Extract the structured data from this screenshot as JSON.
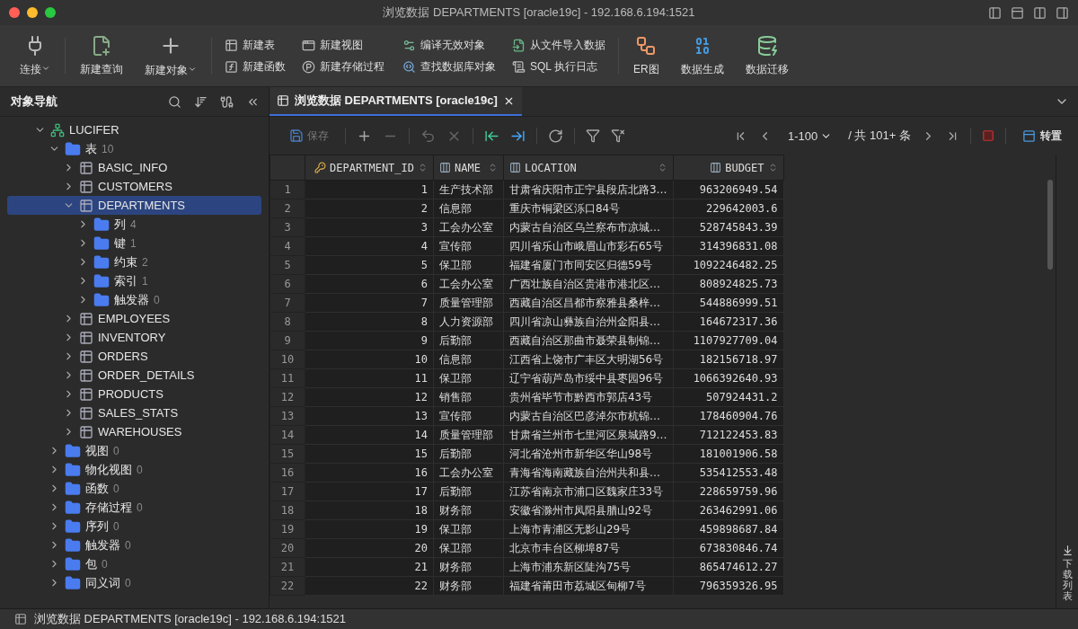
{
  "window": {
    "title": "浏览数据 DEPARTMENTS [oracle19c]  - 192.168.6.194:1521"
  },
  "toolbar": {
    "items": [
      {
        "label": "连接",
        "kind": "large",
        "has_menu": true
      },
      {
        "label": "新建查询",
        "kind": "large"
      },
      {
        "label": "新建对象",
        "kind": "large",
        "has_menu": true
      },
      {
        "label": "新建表",
        "kind": "small"
      },
      {
        "label": "新建函数",
        "kind": "small"
      },
      {
        "label": "新建视图",
        "kind": "small"
      },
      {
        "label": "新建存储过程",
        "kind": "small"
      },
      {
        "label": "编译无效对象",
        "kind": "small"
      },
      {
        "label": "查找数据库对象",
        "kind": "small"
      },
      {
        "label": "从文件导入数据",
        "kind": "small"
      },
      {
        "label": "SQL 执行日志",
        "kind": "small"
      },
      {
        "label": "ER图",
        "kind": "large"
      },
      {
        "label": "数据生成",
        "kind": "large"
      },
      {
        "label": "数据迁移",
        "kind": "large"
      }
    ]
  },
  "sidebar": {
    "title": "对象导航",
    "tree": [
      {
        "label": "LUCIFER",
        "kind": "schema",
        "expanded": true,
        "selected": false,
        "children": [
          {
            "label": "表",
            "count": "10",
            "kind": "folder",
            "expanded": true,
            "selected": false,
            "children": [
              {
                "label": "BASIC_INFO",
                "kind": "table",
                "expanded": false,
                "selected": false
              },
              {
                "label": "CUSTOMERS",
                "kind": "table",
                "expanded": false,
                "selected": false
              },
              {
                "label": "DEPARTMENTS",
                "kind": "table",
                "expanded": true,
                "selected": true,
                "children": [
                  {
                    "label": "列",
                    "count": "4",
                    "kind": "folder",
                    "expanded": false,
                    "selected": false
                  },
                  {
                    "label": "键",
                    "count": "1",
                    "kind": "folder",
                    "expanded": false,
                    "selected": false
                  },
                  {
                    "label": "约束",
                    "count": "2",
                    "kind": "folder",
                    "expanded": false,
                    "selected": false
                  },
                  {
                    "label": "索引",
                    "count": "1",
                    "kind": "folder",
                    "expanded": false,
                    "selected": false
                  },
                  {
                    "label": "触发器",
                    "count": "0",
                    "kind": "folder",
                    "expanded": false,
                    "selected": false
                  }
                ]
              },
              {
                "label": "EMPLOYEES",
                "kind": "table",
                "expanded": false,
                "selected": false
              },
              {
                "label": "INVENTORY",
                "kind": "table",
                "expanded": false,
                "selected": false
              },
              {
                "label": "ORDERS",
                "kind": "table",
                "expanded": false,
                "selected": false
              },
              {
                "label": "ORDER_DETAILS",
                "kind": "table",
                "expanded": false,
                "selected": false
              },
              {
                "label": "PRODUCTS",
                "kind": "table",
                "expanded": false,
                "selected": false
              },
              {
                "label": "SALES_STATS",
                "kind": "table",
                "expanded": false,
                "selected": false
              },
              {
                "label": "WAREHOUSES",
                "kind": "table",
                "expanded": false,
                "selected": false
              }
            ]
          },
          {
            "label": "视图",
            "count": "0",
            "kind": "folder",
            "expanded": false,
            "selected": false
          },
          {
            "label": "物化视图",
            "count": "0",
            "kind": "folder",
            "expanded": false,
            "selected": false
          },
          {
            "label": "函数",
            "count": "0",
            "kind": "folder",
            "expanded": false,
            "selected": false
          },
          {
            "label": "存储过程",
            "count": "0",
            "kind": "folder",
            "expanded": false,
            "selected": false
          },
          {
            "label": "序列",
            "count": "0",
            "kind": "folder",
            "expanded": false,
            "selected": false
          },
          {
            "label": "触发器",
            "count": "0",
            "kind": "folder",
            "expanded": false,
            "selected": false
          },
          {
            "label": "包",
            "count": "0",
            "kind": "folder",
            "expanded": false,
            "selected": false
          },
          {
            "label": "同义词",
            "count": "0",
            "kind": "folder",
            "expanded": false,
            "selected": false
          }
        ]
      }
    ]
  },
  "tabs": [
    {
      "label": "浏览数据 DEPARTMENTS [oracle19c]",
      "selected": true
    }
  ],
  "data_toolbar": {
    "save": {
      "label": "保存",
      "disabled": true
    },
    "page_range": "1-100",
    "total": "/ 共 101+ 条",
    "transpose": "转置"
  },
  "table": {
    "columns": [
      {
        "label": "DEPARTMENT_ID",
        "kind": "key_number"
      },
      {
        "label": "NAME",
        "kind": "text"
      },
      {
        "label": "LOCATION",
        "kind": "text"
      },
      {
        "label": "BUDGET",
        "kind": "number"
      }
    ],
    "row_numbers": [
      "1",
      "2",
      "3",
      "4",
      "5",
      "6",
      "7",
      "8",
      "9",
      "10",
      "11",
      "12",
      "13",
      "14",
      "15",
      "16",
      "17",
      "18",
      "19",
      "20",
      "21",
      "22"
    ],
    "rows": [
      [
        "1",
        "生产技术部",
        "甘肃省庆阳市正宁县段店北路3…",
        "963206949.54"
      ],
      [
        "2",
        "信息部",
        "重庆市铜梁区泺口84号",
        "229642003.6"
      ],
      [
        "3",
        "工会办公室",
        "内蒙古自治区乌兰察布市凉城…",
        "528745843.39"
      ],
      [
        "4",
        "宣传部",
        "四川省乐山市峨眉山市彩石65号",
        "314396831.08"
      ],
      [
        "5",
        "保卫部",
        "福建省厦门市同安区归德59号",
        "1092246482.25"
      ],
      [
        "6",
        "工会办公室",
        "广西壮族自治区贵港市港北区…",
        "808924825.73"
      ],
      [
        "7",
        "质量管理部",
        "西藏自治区昌都市察雅县桑梓…",
        "544886999.51"
      ],
      [
        "8",
        "人力资源部",
        "四川省凉山彝族自治州金阳县…",
        "164672317.36"
      ],
      [
        "9",
        "后勤部",
        "西藏自治区那曲市聂荣县制锦…",
        "1107927709.04"
      ],
      [
        "10",
        "信息部",
        "江西省上饶市广丰区大明湖56号",
        "182156718.97"
      ],
      [
        "11",
        "保卫部",
        "辽宁省葫芦岛市绥中县枣园96号",
        "1066392640.93"
      ],
      [
        "12",
        "销售部",
        "贵州省毕节市黔西市郭店43号",
        "507924431.2"
      ],
      [
        "13",
        "宣传部",
        "内蒙古自治区巴彦淖尔市杭锦…",
        "178460904.76"
      ],
      [
        "14",
        "质量管理部",
        "甘肃省兰州市七里河区泉城路9…",
        "712122453.83"
      ],
      [
        "15",
        "后勤部",
        "河北省沧州市新华区华山98号",
        "181001906.58"
      ],
      [
        "16",
        "工会办公室",
        "青海省海南藏族自治州共和县…",
        "535412553.48"
      ],
      [
        "17",
        "后勤部",
        "江苏省南京市浦口区魏家庄33号",
        "228659759.96"
      ],
      [
        "18",
        "财务部",
        "安徽省滁州市凤阳县腊山92号",
        "263462991.06"
      ],
      [
        "19",
        "保卫部",
        "上海市青浦区无影山29号",
        "459898687.84"
      ],
      [
        "20",
        "保卫部",
        "北京市丰台区柳埠87号",
        "673830846.74"
      ],
      [
        "21",
        "财务部",
        "上海市浦东新区陡沟75号",
        "865474612.27"
      ],
      [
        "22",
        "财务部",
        "福建省莆田市荔城区甸柳7号",
        "796359326.95"
      ]
    ]
  },
  "side_strip": {
    "label": "下载列表"
  },
  "status_bar": {
    "text": "浏览数据 DEPARTMENTS [oracle19c] - 192.168.6.194:1521"
  }
}
